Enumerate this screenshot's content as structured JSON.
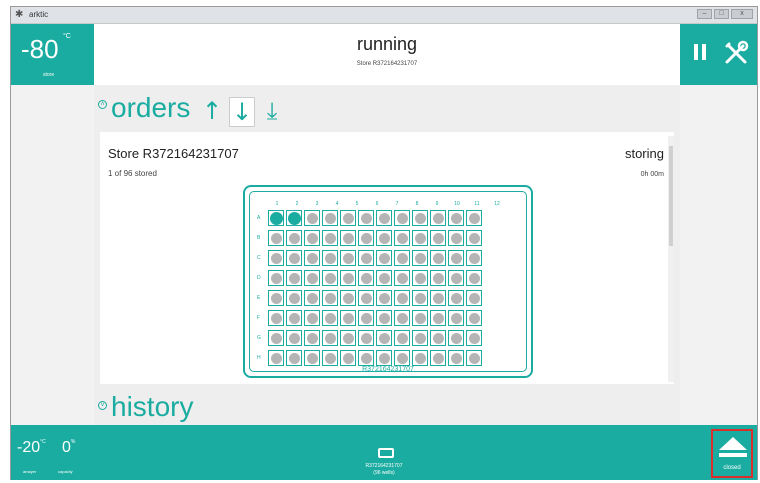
{
  "window": {
    "title": "arktic",
    "controls": [
      "–",
      "□",
      "x"
    ]
  },
  "freezer": {
    "temperature": "-80",
    "unit": "°C",
    "label": "store"
  },
  "header": {
    "status": "running",
    "subtitle": "Store R372164231707"
  },
  "orders": {
    "title": "orders",
    "controls": {
      "up": "↑",
      "down": "↓",
      "download": "⤓"
    },
    "selected_control": "down",
    "card": {
      "store_name": "Store R372164231707",
      "stored_count": "1 of 96 stored",
      "state": "storing",
      "elapsed": "0h 00m"
    },
    "plate": {
      "barcode": "R372164231707",
      "columns": [
        "1",
        "2",
        "3",
        "4",
        "5",
        "6",
        "7",
        "8",
        "9",
        "10",
        "11",
        "12"
      ],
      "rows": [
        "A",
        "B",
        "C",
        "D",
        "E",
        "F",
        "G",
        "H"
      ],
      "stored_wells": [
        "A1",
        "A2"
      ]
    }
  },
  "history": {
    "title": "history"
  },
  "footer": {
    "temp_left": "-20",
    "temp_left_unit": "°C",
    "temp_left_label": "amayer",
    "capacity": "0",
    "capacity_unit": "%",
    "capacity_label": "capacity",
    "plate_barcode": "R372164231707",
    "plate_wells": "(96 wells)",
    "eject_label": "closed"
  },
  "colors": {
    "accent": "#1aaca0",
    "highlight": "#d9302e",
    "empty_well": "#b5b5b5"
  }
}
